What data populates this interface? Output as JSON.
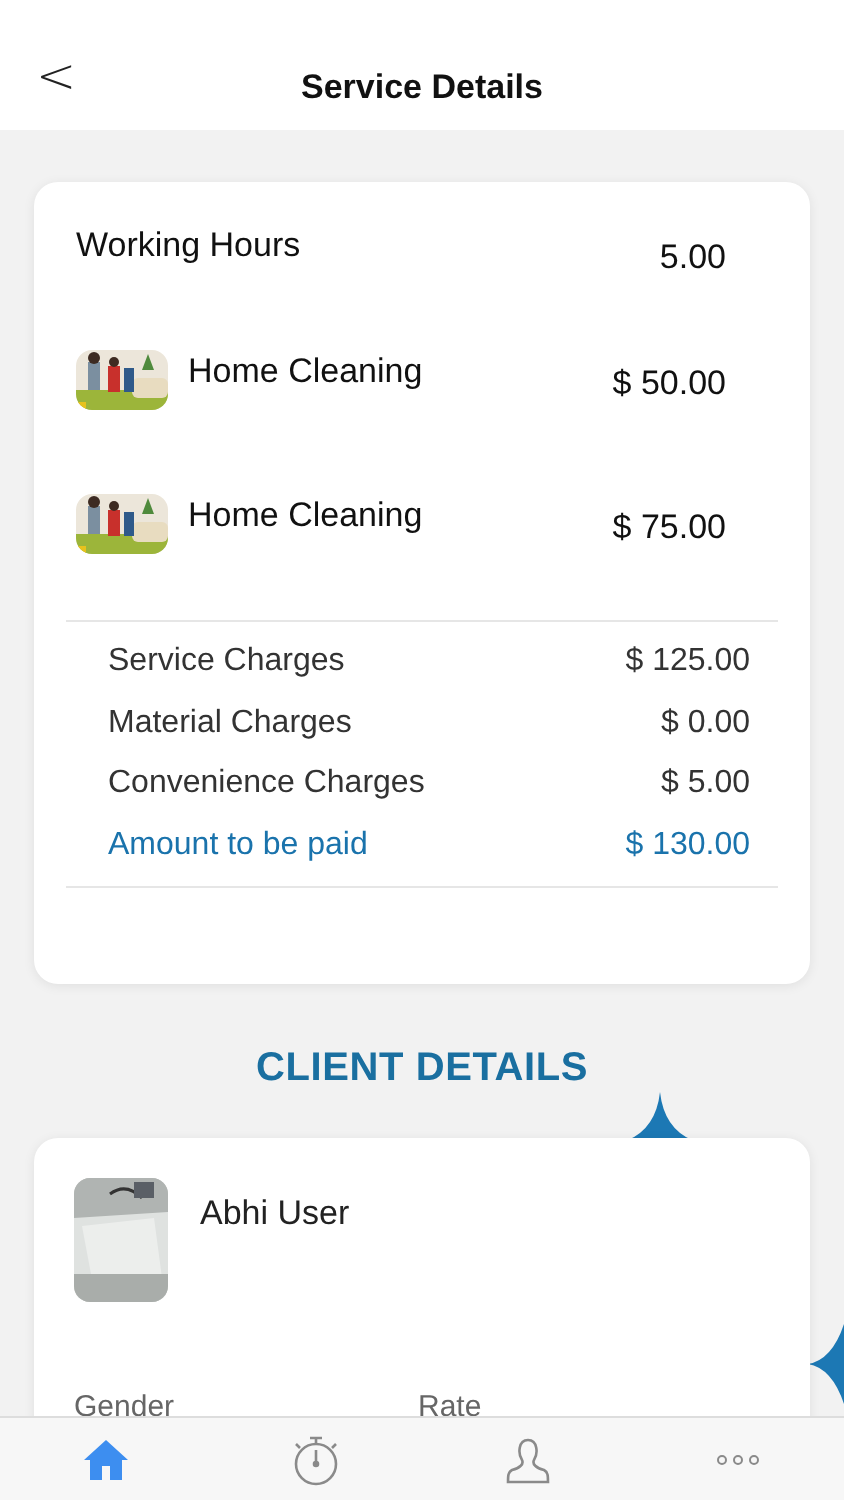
{
  "header": {
    "back": "<",
    "title": "Service Details"
  },
  "service": {
    "working_hours": {
      "label": "Working Hours",
      "value": "5.00"
    },
    "items": [
      {
        "name": "Home Cleaning",
        "price": "$ 50.00"
      },
      {
        "name": "Home Cleaning",
        "price": "$ 75.00"
      }
    ],
    "charges": [
      {
        "label": "Service Charges",
        "value": "$ 125.00",
        "highlight": false
      },
      {
        "label": "Material Charges",
        "value": "$ 0.00",
        "highlight": false
      },
      {
        "label": "Convenience Charges",
        "value": "$ 5.00",
        "highlight": false
      },
      {
        "label": "Amount to be paid",
        "value": "$ 130.00",
        "highlight": true
      }
    ]
  },
  "client": {
    "heading": "CLIENT DETAILS",
    "name": "Abhi User",
    "fields": [
      "Gender",
      "Rate"
    ]
  },
  "tab_bar": [
    {
      "kind": "home",
      "selected": true
    },
    {
      "kind": "timer",
      "selected": false
    },
    {
      "kind": "profile",
      "selected": false
    },
    {
      "kind": "more",
      "selected": false
    }
  ]
}
